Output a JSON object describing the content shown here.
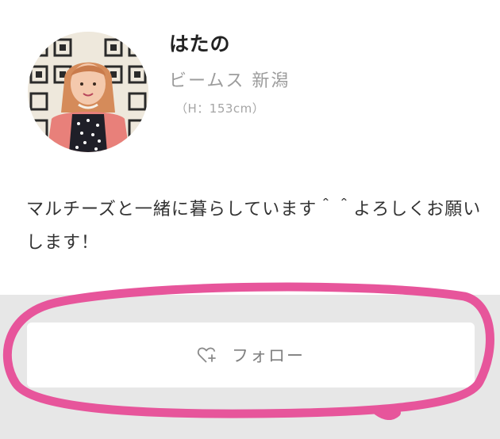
{
  "profile": {
    "name": "はたの",
    "shop": "ビームス 新潟",
    "height": "（H：153cm）",
    "bio": "マルチーズと一緒に暮らしています＾＾よろしくお願いします！"
  },
  "follow": {
    "label": "フォロー",
    "icon": "heart-plus-icon"
  },
  "colors": {
    "highlight": "#e7559b",
    "section_background": "#e7e7e7"
  }
}
